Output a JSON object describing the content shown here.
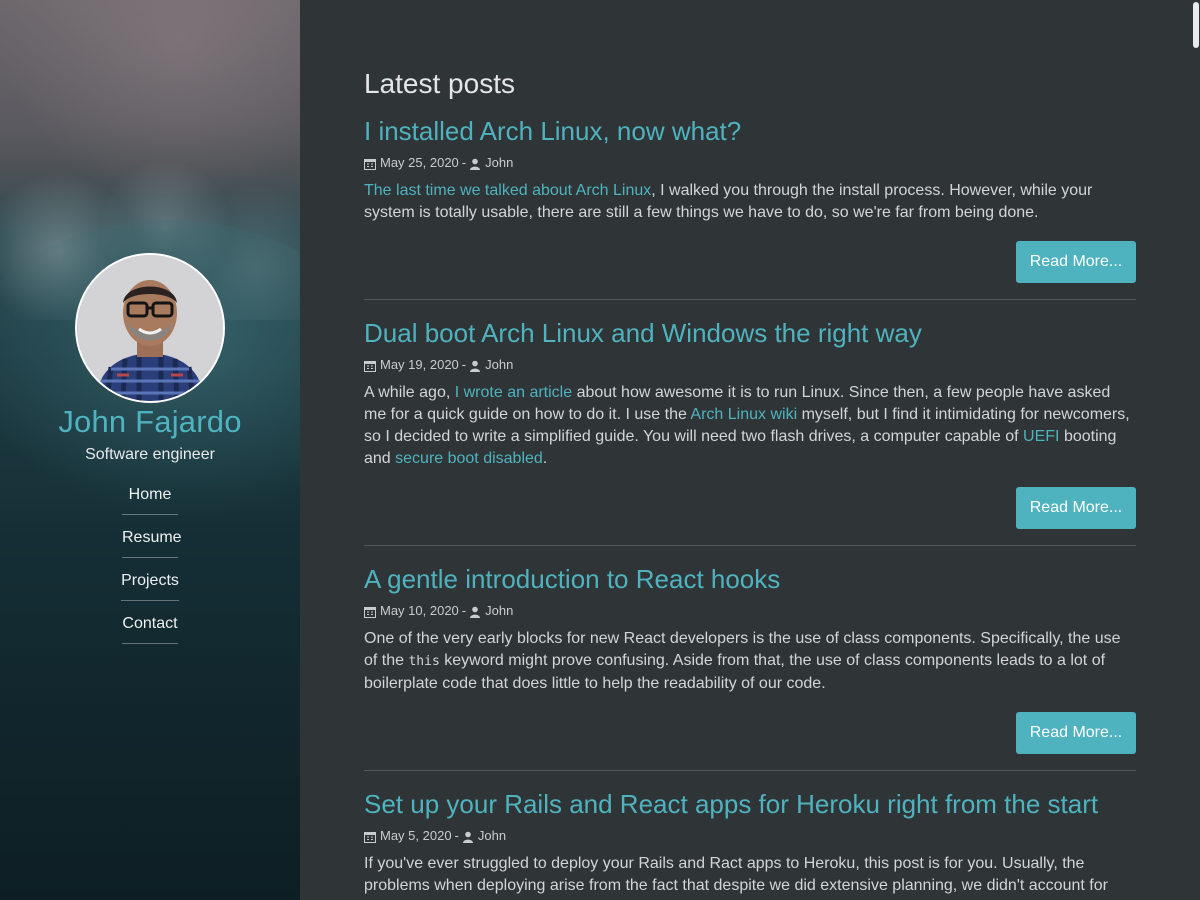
{
  "sidebar": {
    "name": "John Fajardo",
    "role": "Software engineer",
    "nav": [
      "Home",
      "Resume",
      "Projects",
      "Contact"
    ]
  },
  "main": {
    "heading": "Latest posts",
    "read_more": "Read More...",
    "posts": [
      {
        "title": "I installed Arch Linux, now what?",
        "date": "May 25, 2020",
        "sep": "-",
        "author": "John",
        "excerpt": [
          {
            "t": "The last time we talked about Arch Linux",
            "link": true
          },
          {
            "t": ", I walked you through the install process. However, while your system is totally usable, there are still a few things we have to do, so we're far from being done."
          }
        ]
      },
      {
        "title": "Dual boot Arch Linux and Windows the right way",
        "date": "May 19, 2020",
        "sep": "-",
        "author": "John",
        "excerpt": [
          {
            "t": "A while ago, "
          },
          {
            "t": "I wrote an article",
            "link": true
          },
          {
            "t": " about how awesome it is to run Linux. Since then, a few people have asked me for a quick guide on how to do it. I use the "
          },
          {
            "t": "Arch Linux wiki",
            "link": true
          },
          {
            "t": " myself, but I find it intimidating for newcomers, so I decided to write a simplified guide. You will need two flash drives, a computer capable of "
          },
          {
            "t": "UEFI",
            "link": true
          },
          {
            "t": " booting and "
          },
          {
            "t": "secure boot disabled",
            "link": true
          },
          {
            "t": "."
          }
        ]
      },
      {
        "title": "A gentle introduction to React hooks",
        "date": "May 10, 2020",
        "sep": "-",
        "author": "John",
        "excerpt": [
          {
            "t": "One of the very early blocks for new React developers is the use of class components. Specifically, the use of the "
          },
          {
            "t": "this",
            "code": true
          },
          {
            "t": " keyword might prove confusing. Aside from that, the use of class components leads to a lot of boilerplate code that does little to help the readability of our code."
          }
        ]
      },
      {
        "title": "Set up your Rails and React apps for Heroku right from the start",
        "date": "May 5, 2020",
        "sep": "-",
        "author": "John",
        "excerpt": [
          {
            "t": "If you've ever struggled to deploy your Rails and Ract apps to Heroku, this post is for you. Usually, the problems when deploying arise from the fact that despite we did extensive planning, we didn't account for"
          }
        ]
      }
    ]
  },
  "colors": {
    "accent": "#4fb3bf",
    "background": "#2f3437",
    "text": "#d2d5d8"
  },
  "icons": {
    "calendar": "calendar-icon",
    "user": "user-icon"
  }
}
